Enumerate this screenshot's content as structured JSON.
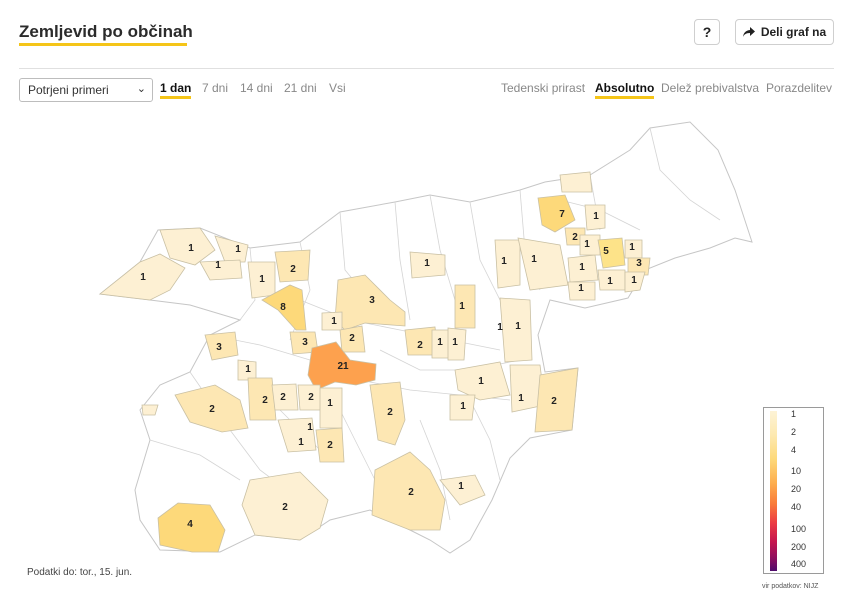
{
  "header": {
    "title": "Zemljevid po občinah",
    "help_label": "?",
    "share_label": "Deli graf na"
  },
  "controls": {
    "select_value": "Potrjeni primeri",
    "time_tabs": [
      "1 dan",
      "7 dni",
      "14 dni",
      "21 dni",
      "Vsi"
    ],
    "time_active": "1 dan",
    "mode_tabs": [
      "Tedenski prirast",
      "Absolutno",
      "Delež prebivalstva",
      "Porazdelitev"
    ],
    "mode_active": "Absolutno"
  },
  "map": {
    "values": [
      {
        "label": "1"
      },
      {
        "label": "1"
      },
      {
        "label": "1"
      },
      {
        "label": "1"
      },
      {
        "label": "2"
      },
      {
        "label": "8"
      },
      {
        "label": "3"
      },
      {
        "label": "1"
      },
      {
        "label": "3"
      },
      {
        "label": "3"
      },
      {
        "label": "1"
      },
      {
        "label": "2"
      },
      {
        "label": "21"
      },
      {
        "label": "1"
      },
      {
        "label": "2"
      },
      {
        "label": "2"
      },
      {
        "label": "2"
      },
      {
        "label": "2"
      },
      {
        "label": "1"
      },
      {
        "label": "1"
      },
      {
        "label": "2"
      },
      {
        "label": "2"
      },
      {
        "label": "4"
      },
      {
        "label": "2"
      },
      {
        "label": "2"
      },
      {
        "label": "1"
      },
      {
        "label": "1"
      },
      {
        "label": "1"
      },
      {
        "label": "1"
      },
      {
        "label": "1"
      },
      {
        "label": "2"
      },
      {
        "label": "1"
      },
      {
        "label": "1"
      },
      {
        "label": "1"
      },
      {
        "label": "1"
      },
      {
        "label": "1"
      },
      {
        "label": "1"
      },
      {
        "label": "1"
      },
      {
        "label": "1"
      },
      {
        "label": "1"
      },
      {
        "label": "7"
      },
      {
        "label": "1"
      },
      {
        "label": "2"
      },
      {
        "label": "1"
      },
      {
        "label": "5"
      },
      {
        "label": "1"
      },
      {
        "label": "3"
      },
      {
        "label": "1"
      },
      {
        "label": "1"
      },
      {
        "label": "1"
      },
      {
        "label": "2"
      }
    ]
  },
  "legend": {
    "labels": [
      "1",
      "2",
      "4",
      "10",
      "20",
      "40",
      "100",
      "200",
      "400"
    ],
    "colors": [
      "#fdf3d6",
      "#fde9b0",
      "#fdd97a",
      "#fdae4f",
      "#f97b3a",
      "#ec3b43",
      "#c4154f",
      "#8e0f5e",
      "#4f0b6b"
    ]
  },
  "footer": {
    "date": "Podatki do: tor., 15. jun.",
    "source": "vir podatkov: NIJZ"
  }
}
